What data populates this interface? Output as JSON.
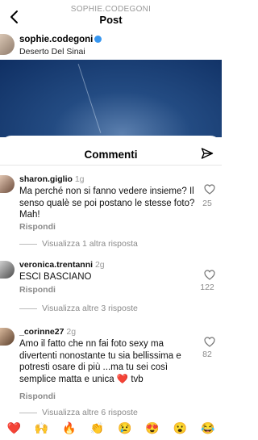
{
  "header": {
    "account": "SOPHIE.CODEGONI",
    "title": "Post"
  },
  "post": {
    "username": "sophie.codegoni",
    "location": "Deserto Del Sinai"
  },
  "comments_sheet": {
    "title": "Commenti",
    "comments": [
      {
        "username": "sharon.giglio",
        "time": "1g",
        "text": "Ma perché non si fanno vedere insieme? Il senso qualè se poi postano le stesse foto? Mah!",
        "reply_label": "Rispondi",
        "likes": "25",
        "more_replies": "Visualizza 1 altra risposta"
      },
      {
        "username": "veronica.trentanni",
        "time": "2g",
        "text": "ESCI BASCIANO",
        "reply_label": "Rispondi",
        "likes": "122",
        "more_replies": "Visualizza altre 3 risposte"
      },
      {
        "username": "_corinne27",
        "time": "2g",
        "text": "Amo il fatto che nn fai foto sexy ma divertenti nonostante tu sia bellissima e potresti osare di più ...ma tu sei così semplice matta e unica ❤️ tvb",
        "reply_label": "Rispondi",
        "likes": "82",
        "more_replies": "Visualizza altre 6 risposte"
      }
    ]
  },
  "emoji_bar": [
    "❤️",
    "🙌",
    "🔥",
    "👏",
    "😢",
    "😍",
    "😮",
    "😂"
  ]
}
